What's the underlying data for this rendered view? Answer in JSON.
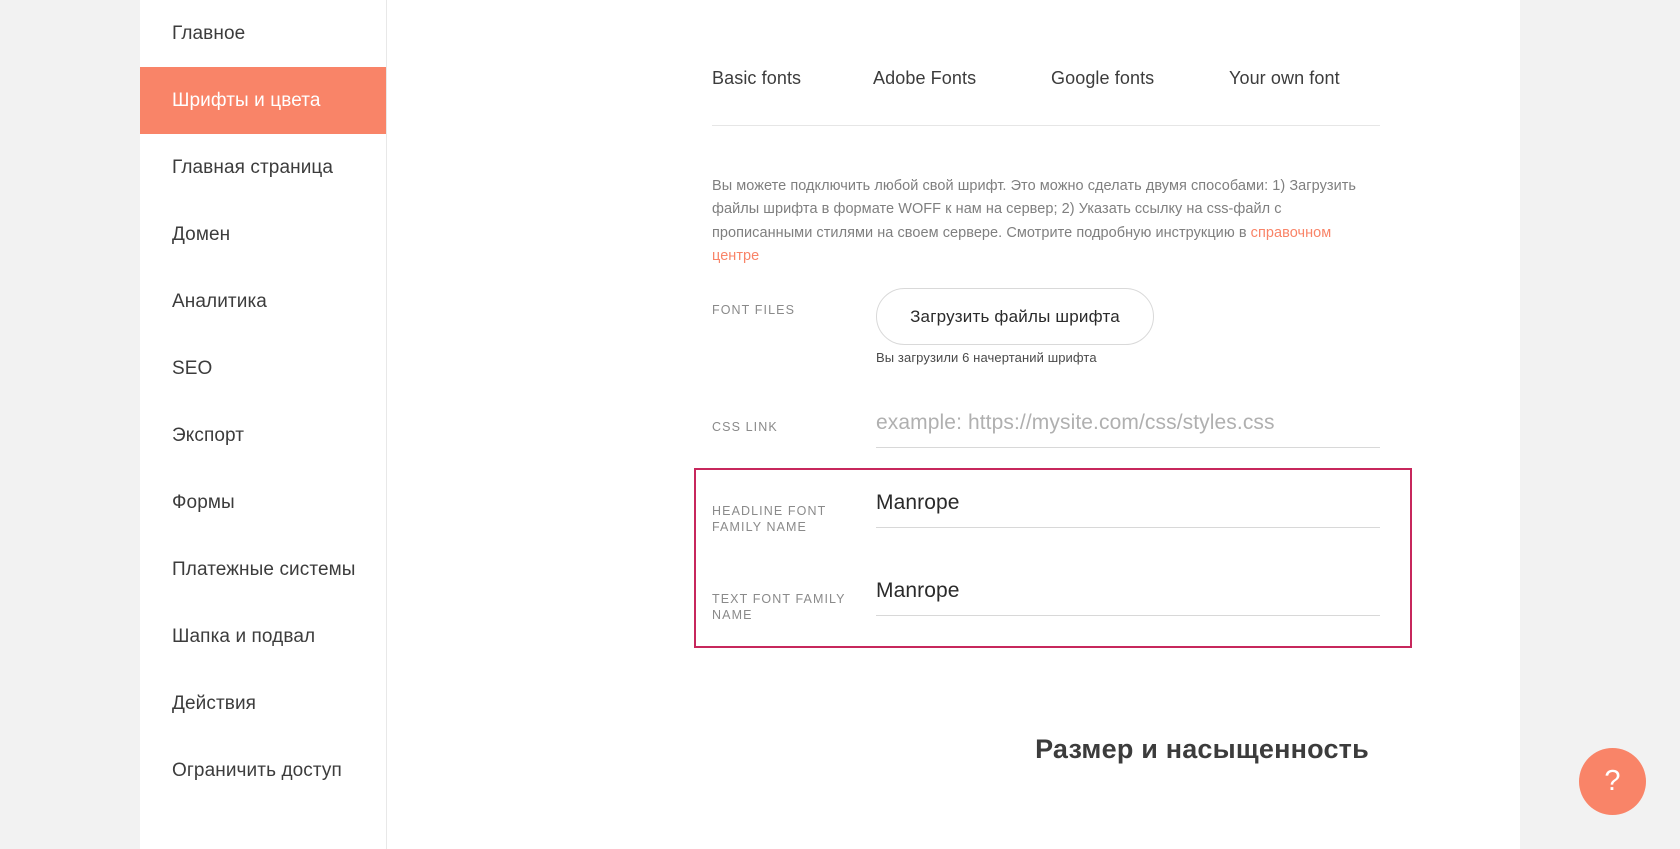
{
  "sidebar": {
    "items": [
      {
        "label": "Главное",
        "active": false
      },
      {
        "label": "Шрифты и цвета",
        "active": true
      },
      {
        "label": "Главная страница",
        "active": false
      },
      {
        "label": "Домен",
        "active": false
      },
      {
        "label": "Аналитика",
        "active": false
      },
      {
        "label": "SEO",
        "active": false
      },
      {
        "label": "Экспорт",
        "active": false
      },
      {
        "label": "Формы",
        "active": false
      },
      {
        "label": "Платежные системы",
        "active": false
      },
      {
        "label": "Шапка и подвал",
        "active": false
      },
      {
        "label": "Действия",
        "active": false
      },
      {
        "label": "Ограничить доступ",
        "active": false
      }
    ]
  },
  "tabs": [
    {
      "label": "Basic fonts",
      "active": false
    },
    {
      "label": "Adobe Fonts",
      "active": false
    },
    {
      "label": "Google fonts",
      "active": false
    },
    {
      "label": "Your own font",
      "active": true
    }
  ],
  "description": {
    "part1": "Вы можете подключить любой свой шрифт. Это можно сделать двумя способами: 1) Загрузить файлы шрифта в формате WOFF к нам на сервер; 2) Указать ссылку на css-файл с прописанными стилями на своем сервере. Смотрите подробную инструкцию в ",
    "link_text": "справочном центре"
  },
  "form": {
    "font_files": {
      "label": "FONT FILES",
      "button_label": "Загрузить файлы шрифта",
      "caption": "Вы загрузили 6 начертаний шрифта"
    },
    "css_link": {
      "label": "CSS LINK",
      "value": "",
      "placeholder": "example: https://mysite.com/css/styles.css"
    },
    "headline_font": {
      "label": "HEADLINE FONT FAMILY NAME",
      "value": "Manrope",
      "placeholder": ""
    },
    "text_font": {
      "label": "TEXT FONT FAMILY NAME",
      "value": "Manrope",
      "placeholder": ""
    }
  },
  "section_heading": "Размер и насыщенность",
  "help": {
    "icon": "question-mark-icon",
    "label": "?"
  },
  "colors": {
    "accent": "#f98468",
    "highlight_border": "#c7275c",
    "text_primary": "#3c3c3c",
    "text_muted": "#8a8a8a",
    "page_background": "#f2f2f2"
  }
}
